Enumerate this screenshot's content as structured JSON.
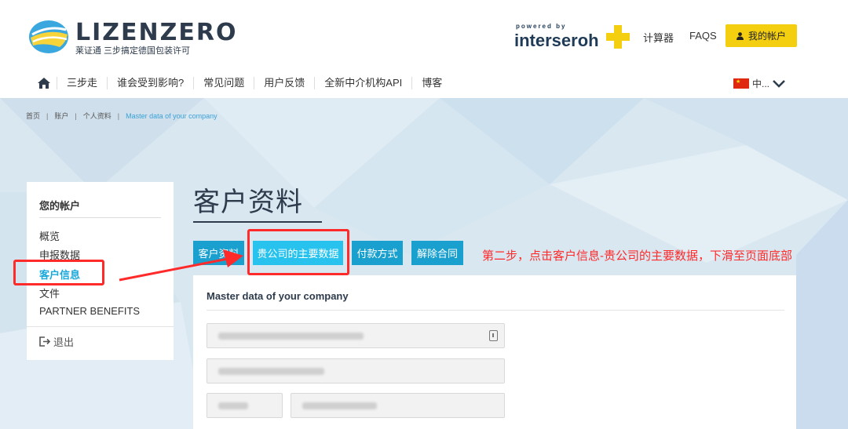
{
  "header": {
    "brand": "LIZENZERO",
    "brand_sub": "莱证通  三步搞定德国包装许可",
    "powered_small": "powered by",
    "powered_brand": "interseroh",
    "links": {
      "calculator": "计算器",
      "faqs": "FAQS"
    },
    "account_button": "我的帐户"
  },
  "nav": {
    "items": [
      "三步走",
      "谁会受到影响?",
      "常见问题",
      "用户反馈",
      "全新中介机构API",
      "博客"
    ],
    "language": "中..."
  },
  "breadcrumb": [
    "首页",
    "账户",
    "个人资料",
    "Master data of your company"
  ],
  "sidebar": {
    "title": "您的帐户",
    "items": [
      "概览",
      "申报数据",
      "客户信息",
      "文件",
      "PARTNER BENEFITS"
    ],
    "logout": "退出"
  },
  "main": {
    "title": "客户资料",
    "tabs": [
      "客户资料",
      "贵公司的主要数据",
      "付款方式",
      "解除合同"
    ],
    "annotation": "第二步，点击客户信息-贵公司的主要数据，下滑至页面底部",
    "card_title": "Master data of your company"
  },
  "colors": {
    "accent": "#1aa0cf",
    "active_tab": "#27c3ee",
    "brand_yellow": "#f4cf10",
    "annotation_red": "#ff2a2a"
  }
}
